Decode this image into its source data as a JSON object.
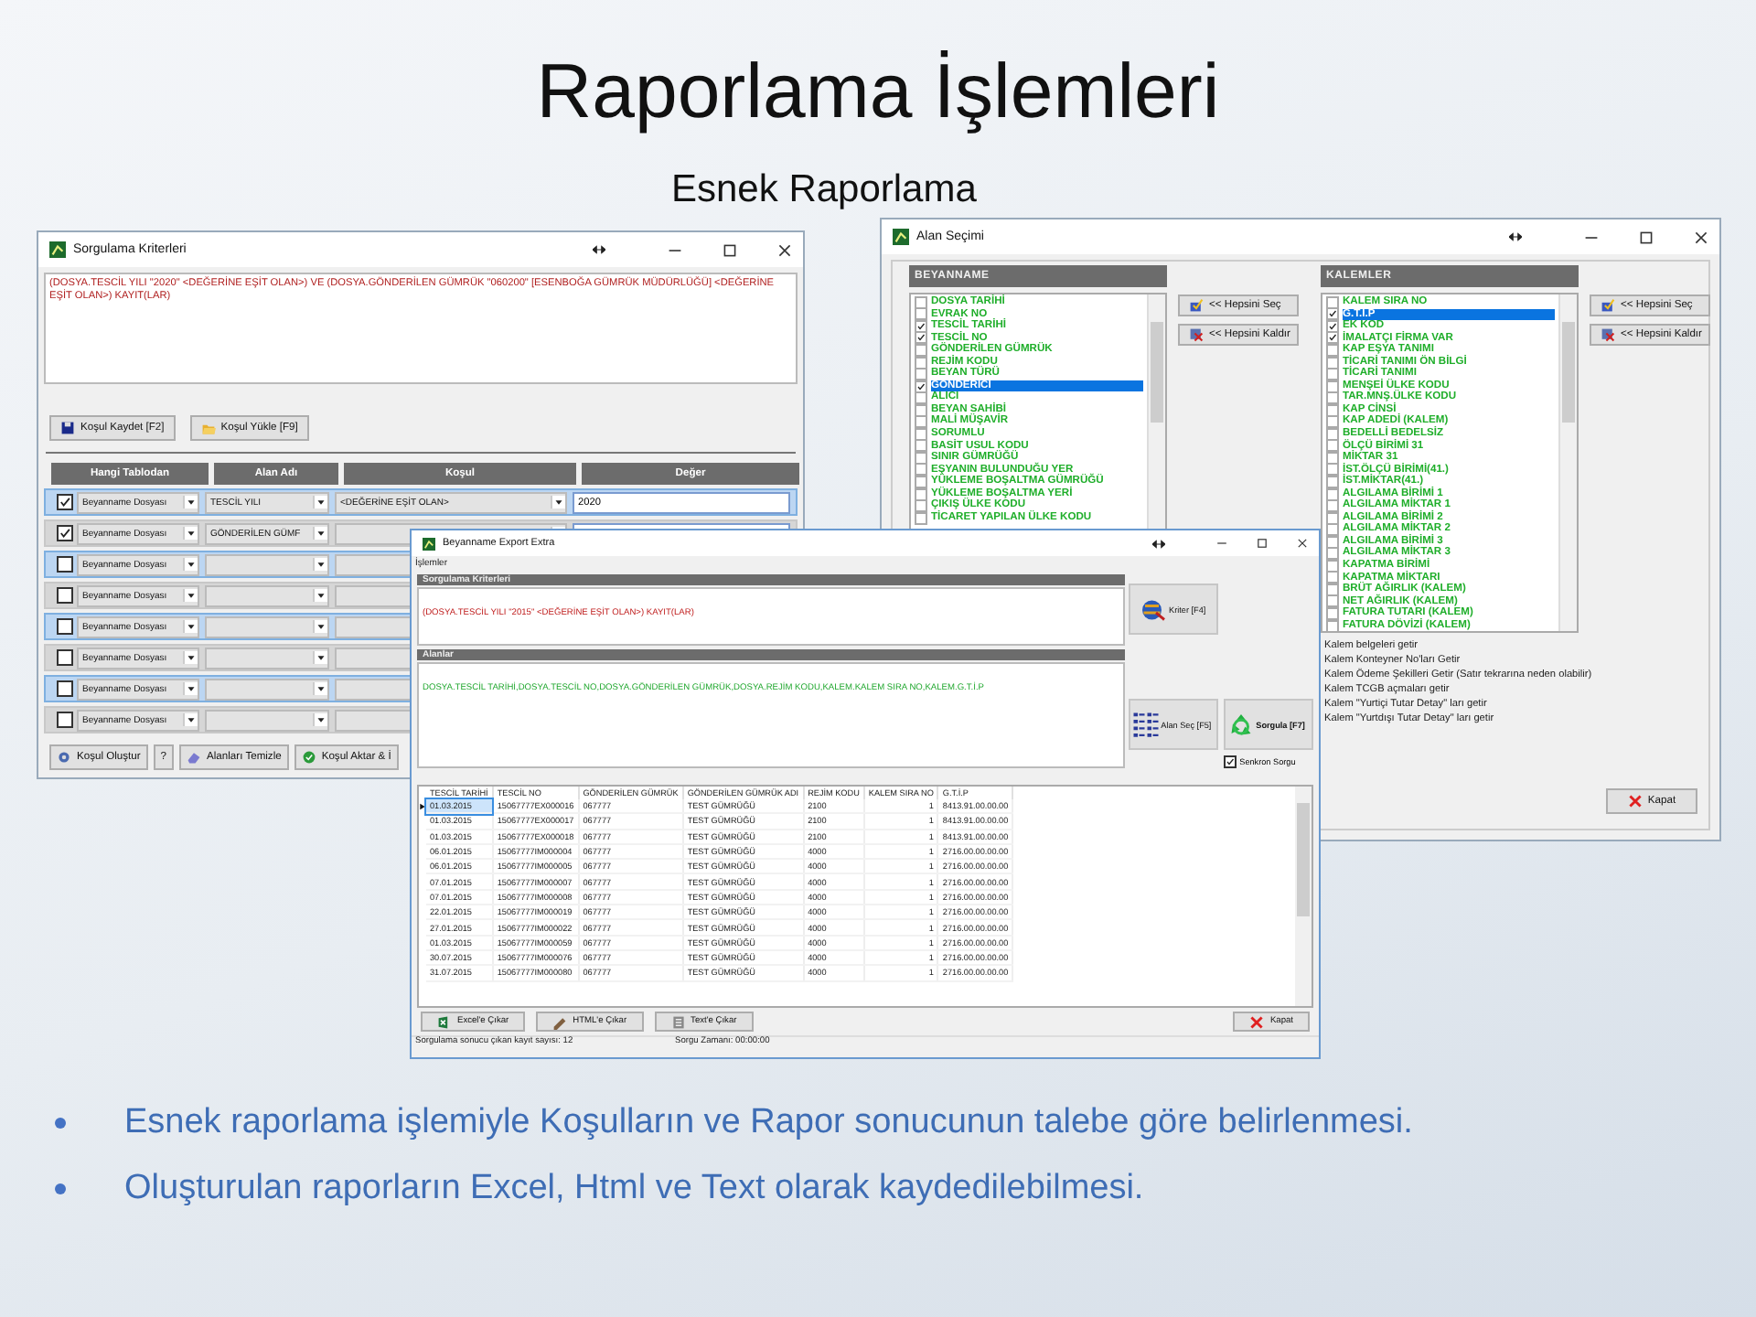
{
  "slide": {
    "title": "Raporlama İşlemleri",
    "subtitle": "Esnek Raporlama",
    "bullets": [
      "Esnek raporlama işlemiyle Koşulların ve Rapor sonucunun talebe göre belirlenmesi.",
      "Oluşturulan raporların Excel, Html ve Text olarak kaydedilebilmesi."
    ]
  },
  "criteria_window": {
    "title": "Sorgulama Kriterleri",
    "criteria_text": "(DOSYA.TESCİL YILI \"2020\" <DEĞERİNE EŞİT OLAN>)  VE  (DOSYA.GÖNDERİLEN GÜMRÜK \"060200\" [ESENBOĞA GÜMRÜK MÜDÜRLÜĞÜ] <DEĞERİNE EŞİT OLAN>) KAYIT(LAR)",
    "buttons": [
      {
        "kind": "save",
        "label": "Koşul Kaydet [F2]"
      },
      {
        "kind": "load",
        "label": "Koşul Yükle [F9]"
      }
    ],
    "columns": [
      "Hangi Tablodan",
      "Alan Adı",
      "Koşul",
      "Değer"
    ],
    "rows": [
      {
        "checked": true,
        "table": "Beyanname Dosyası",
        "field": "TESCİL YILI",
        "condition": "<DEĞERİNE EŞİT OLAN>",
        "value": "2020"
      },
      {
        "checked": true,
        "table": "Beyanname Dosyası",
        "field": "GÖNDERİLEN GÜMF"
      },
      {
        "checked": false,
        "table": "Beyanname Dosyası"
      },
      {
        "checked": false,
        "table": "Beyanname Dosyası"
      },
      {
        "checked": false,
        "table": "Beyanname Dosyası"
      },
      {
        "checked": false,
        "table": "Beyanname Dosyası"
      },
      {
        "checked": false,
        "table": "Beyanname Dosyası"
      },
      {
        "checked": false,
        "table": "Beyanname Dosyası"
      }
    ],
    "bottom_buttons": [
      {
        "kind": "create",
        "label": "Koşul Oluştur"
      },
      {
        "kind": "help",
        "label": "?"
      },
      {
        "kind": "clear",
        "label": "Alanları Temizle"
      },
      {
        "kind": "transfer",
        "label": "Koşul Aktar & İ"
      }
    ]
  },
  "field_window": {
    "title": "Alan Seçimi",
    "groups": [
      {
        "heading": "BEYANNAME",
        "buttons": [
          {
            "kind": "select_all",
            "label": "<< Hepsini Seç"
          },
          {
            "kind": "clear_all",
            "label": "<< Hepsini Kaldır"
          }
        ],
        "items": [
          {
            "label": "DOSYA TARİHİ",
            "checked": false,
            "selected": false
          },
          {
            "label": "EVRAK NO",
            "checked": false,
            "selected": false
          },
          {
            "label": "TESCİL TARİHİ",
            "checked": true,
            "selected": false
          },
          {
            "label": "TESCİL NO",
            "checked": true,
            "selected": false
          },
          {
            "label": "GÖNDERİLEN GÜMRÜK",
            "checked": false,
            "selected": false
          },
          {
            "label": "REJİM KODU",
            "checked": false,
            "selected": false
          },
          {
            "label": "BEYAN TÜRÜ",
            "checked": false,
            "selected": false
          },
          {
            "label": "GÖNDERİCİ",
            "checked": true,
            "selected": true
          },
          {
            "label": "ALICI",
            "checked": false,
            "selected": false
          },
          {
            "label": "BEYAN SAHİBİ",
            "checked": false,
            "selected": false
          },
          {
            "label": "MALİ MÜŞAVİR",
            "checked": false,
            "selected": false
          },
          {
            "label": "SORUMLU",
            "checked": false,
            "selected": false
          },
          {
            "label": "BASİT USUL KODU",
            "checked": false,
            "selected": false
          },
          {
            "label": "SINIR GÜMRÜĞÜ",
            "checked": false,
            "selected": false
          },
          {
            "label": "EŞYANIN BULUNDUĞU YER",
            "checked": false,
            "selected": false
          },
          {
            "label": "YÜKLEME BOŞALTMA GÜMRÜĞÜ",
            "checked": false,
            "selected": false
          },
          {
            "label": "YÜKLEME BOŞALTMA YERİ",
            "checked": false,
            "selected": false
          },
          {
            "label": "ÇIKIŞ ÜLKE KODU",
            "checked": false,
            "selected": false
          },
          {
            "label": "TİCARET YAPILAN ÜLKE KODU",
            "checked": false,
            "selected": false
          }
        ]
      },
      {
        "heading": "KALEMLER",
        "buttons": [
          {
            "kind": "select_all",
            "label": "<< Hepsini Seç"
          },
          {
            "kind": "clear_all",
            "label": "<< Hepsini Kaldır"
          }
        ],
        "items": [
          {
            "label": "KALEM SIRA NO",
            "checked": false,
            "selected": false
          },
          {
            "label": "G.T.İ.P",
            "checked": true,
            "selected": true
          },
          {
            "label": "EK KOD",
            "checked": true,
            "selected": false
          },
          {
            "label": "İMALATÇI FİRMA VAR",
            "checked": true,
            "selected": false
          },
          {
            "label": "KAP EŞYA TANIMI",
            "checked": false,
            "selected": false
          },
          {
            "label": "TİCARİ TANIMI ÖN BİLGİ",
            "checked": false,
            "selected": false
          },
          {
            "label": "TİCARİ TANIMI",
            "checked": false,
            "selected": false
          },
          {
            "label": "MENŞEİ ÜLKE KODU",
            "checked": false,
            "selected": false
          },
          {
            "label": "TAR.MNŞ.ÜLKE KODU",
            "checked": false,
            "selected": false
          },
          {
            "label": "KAP CİNSİ",
            "checked": false,
            "selected": false
          },
          {
            "label": "KAP ADEDİ (KALEM)",
            "checked": false,
            "selected": false
          },
          {
            "label": "BEDELLİ BEDELSİZ",
            "checked": false,
            "selected": false
          },
          {
            "label": "ÖLÇÜ BİRİMİ 31",
            "checked": false,
            "selected": false
          },
          {
            "label": "MİKTAR 31",
            "checked": false,
            "selected": false
          },
          {
            "label": "İST.ÖLÇÜ BİRİMİ(41.)",
            "checked": false,
            "selected": false
          },
          {
            "label": "İST.MİKTAR(41.)",
            "checked": false,
            "selected": false
          },
          {
            "label": "ALGILAMA BİRİMİ 1",
            "checked": false,
            "selected": false
          },
          {
            "label": "ALGILAMA MİKTAR 1",
            "checked": false,
            "selected": false
          },
          {
            "label": "ALGILAMA BİRİMİ 2",
            "checked": false,
            "selected": false
          },
          {
            "label": "ALGILAMA MİKTAR 2",
            "checked": false,
            "selected": false
          },
          {
            "label": "ALGILAMA BİRİMİ 3",
            "checked": false,
            "selected": false
          },
          {
            "label": "ALGILAMA MİKTAR 3",
            "checked": false,
            "selected": false
          },
          {
            "label": "KAPATMA BİRİMİ",
            "checked": false,
            "selected": false
          },
          {
            "label": "KAPATMA MİKTARI",
            "checked": false,
            "selected": false
          },
          {
            "label": "BRÜT AĞIRLIK (KALEM)",
            "checked": false,
            "selected": false
          },
          {
            "label": "NET AĞIRLIK (KALEM)",
            "checked": false,
            "selected": false
          },
          {
            "label": "FATURA TUTARI (KALEM)",
            "checked": false,
            "selected": false
          },
          {
            "label": "FATURA DÖVİZİ (KALEM)",
            "checked": false,
            "selected": false
          }
        ]
      }
    ],
    "options": [
      "Kalem belgeleri getir",
      "Kalem Konteyner No'ları Getir",
      "Kalem Ödeme Şekilleri Getir (Satır tekrarına neden olabilir)",
      "Kalem TCGB açmaları getir",
      "Kalem \"Yurtiçi Tutar Detay\" ları getir",
      "Kalem \"Yurtdışı Tutar Detay\" ları getir"
    ],
    "close_button": "Kapat"
  },
  "export_window": {
    "title": "Beyanname Export Extra",
    "menu": [
      "İşlemler"
    ],
    "criteria_heading": "Sorgulama Kriterleri",
    "criteria_text": "(DOSYA.TESCİL YILI \"2015\" <DEĞERİNE EŞİT OLAN>) KAYIT(LAR)",
    "fields_heading": "Alanlar",
    "fields_text": "DOSYA.TESCİL TARİHİ,DOSYA.TESCİL NO,DOSYA.GÖNDERİLEN GÜMRÜK,DOSYA.REJİM KODU,KALEM.KALEM SIRA NO,KALEM.G.T.İ.P",
    "buttons": [
      {
        "kind": "criteria",
        "label": "Kriter [F4]"
      },
      {
        "kind": "fields",
        "label": "Alan Seç [F5]"
      },
      {
        "kind": "query",
        "label": "Sorgula [F7]"
      }
    ],
    "sync": {
      "label": "Senkron Sorgu",
      "checked": true
    },
    "table": {
      "columns": [
        "TESCİL TARİHİ",
        "TESCİL NO",
        "GÖNDERİLEN GÜMRÜK",
        "GÖNDERİLEN GÜMRÜK ADI",
        "REJİM KODU",
        "KALEM SIRA NO",
        "G.T.İ.P"
      ],
      "rows": [
        {
          "selected": true,
          "cells": [
            "01.03.2015",
            "15067777EX000016",
            "067777",
            "TEST GÜMRÜĞÜ",
            "2100",
            "1",
            "8413.91.00.00.00"
          ]
        },
        {
          "selected": false,
          "cells": [
            "01.03.2015",
            "15067777EX000017",
            "067777",
            "TEST GÜMRÜĞÜ",
            "2100",
            "1",
            "8413.91.00.00.00"
          ]
        },
        {
          "selected": false,
          "cells": [
            "01.03.2015",
            "15067777EX000018",
            "067777",
            "TEST GÜMRÜĞÜ",
            "2100",
            "1",
            "8413.91.00.00.00"
          ]
        },
        {
          "selected": false,
          "cells": [
            "06.01.2015",
            "15067777IM000004",
            "067777",
            "TEST GÜMRÜĞÜ",
            "4000",
            "1",
            "2716.00.00.00.00"
          ]
        },
        {
          "selected": false,
          "cells": [
            "06.01.2015",
            "15067777IM000005",
            "067777",
            "TEST GÜMRÜĞÜ",
            "4000",
            "1",
            "2716.00.00.00.00"
          ]
        },
        {
          "selected": false,
          "cells": [
            "07.01.2015",
            "15067777IM000007",
            "067777",
            "TEST GÜMRÜĞÜ",
            "4000",
            "1",
            "2716.00.00.00.00"
          ]
        },
        {
          "selected": false,
          "cells": [
            "07.01.2015",
            "15067777IM000008",
            "067777",
            "TEST GÜMRÜĞÜ",
            "4000",
            "1",
            "2716.00.00.00.00"
          ]
        },
        {
          "selected": false,
          "cells": [
            "22.01.2015",
            "15067777IM000019",
            "067777",
            "TEST GÜMRÜĞÜ",
            "4000",
            "1",
            "2716.00.00.00.00"
          ]
        },
        {
          "selected": false,
          "cells": [
            "27.01.2015",
            "15067777IM000022",
            "067777",
            "TEST GÜMRÜĞÜ",
            "4000",
            "1",
            "2716.00.00.00.00"
          ]
        },
        {
          "selected": false,
          "cells": [
            "01.03.2015",
            "15067777IM000059",
            "067777",
            "TEST GÜMRÜĞÜ",
            "4000",
            "1",
            "2716.00.00.00.00"
          ]
        },
        {
          "selected": false,
          "cells": [
            "30.07.2015",
            "15067777IM000076",
            "067777",
            "TEST GÜMRÜĞÜ",
            "4000",
            "1",
            "2716.00.00.00.00"
          ]
        },
        {
          "selected": false,
          "cells": [
            "31.07.2015",
            "15067777IM000080",
            "067777",
            "TEST GÜMRÜĞÜ",
            "4000",
            "1",
            "2716.00.00.00.00"
          ]
        }
      ]
    },
    "export_buttons": [
      {
        "kind": "excel",
        "label": "Excel'e Çıkar"
      },
      {
        "kind": "html",
        "label": "HTML'e Çıkar"
      },
      {
        "kind": "text",
        "label": "Text'e Çıkar"
      }
    ],
    "close_button": "Kapat",
    "status": [
      "Sorgulama sonucu çıkan kayıt sayısı: 12",
      "Sorgu Zamanı: 00:00:00"
    ]
  }
}
